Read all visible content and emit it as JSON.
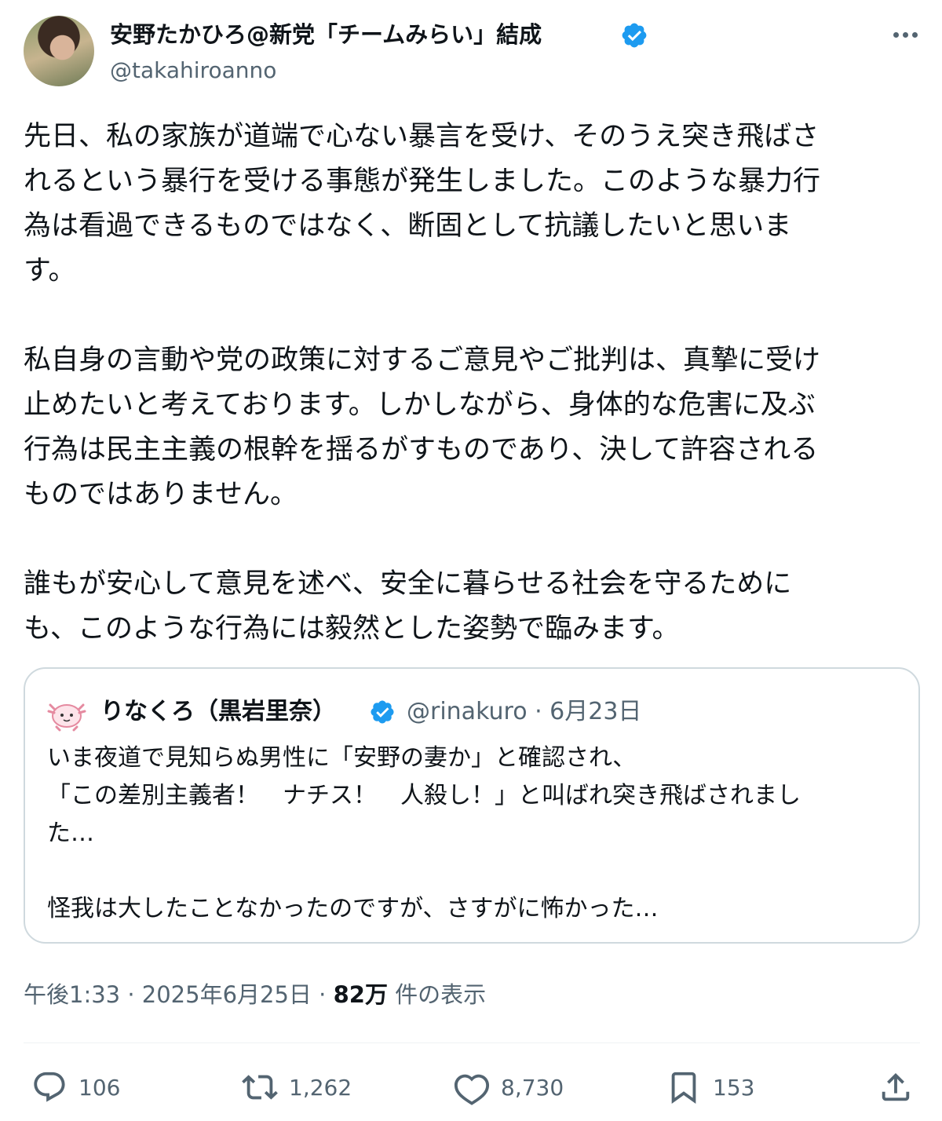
{
  "author": {
    "name": "安野たかひろ@新党「チームみらい」結成",
    "handle": "@takahiroanno"
  },
  "tweet": {
    "lines": [
      "先日、私の家族が道端で心ない暴言を受け、そのうえ突き飛ばさ",
      "れるという暴行を受ける事態が発生しました。このような暴力行",
      "為は看過できるものではなく、断固として抗議したいと思いま",
      "す。",
      "私自身の言動や党の政策に対するご意見やご批判は、真摯に受け",
      "止めたいと考えております。しかしながら、身体的な危害に及ぶ",
      "行為は民主主義の根幹を揺るがすものであり、決して許容される",
      "ものではありません。",
      "誰もが安心して意見を述べ、安全に暮らせる社会を守るために",
      "も、このような行為には毅然とした姿勢で臨みます。"
    ]
  },
  "quote": {
    "name": "りなくろ（黒岩里奈）",
    "meta": "@rinakuro · 6月23日",
    "lines": [
      "いま夜道で見知らぬ男性に「安野の妻か」と確認され、",
      "「この差別主義者！　ナチス！　人殺し！」と叫ばれ突き飛ばされまし",
      "た…",
      "怪我は大したことなかったのですが、さすがに怖かった…"
    ]
  },
  "meta": {
    "time": "午後1:33 · 2025年6月25日 · ",
    "views": "82万",
    "views_label": " 件の表示"
  },
  "actions": {
    "replies": "106",
    "reposts": "1,262",
    "likes": "8,730",
    "bookmarks": "153"
  },
  "icons": {
    "verified_color": "#1d9bf0",
    "action_color": "#536471",
    "more": "more-icon",
    "reply": "reply-icon",
    "repost": "repost-icon",
    "like": "like-icon",
    "bookmark": "bookmark-icon",
    "share": "share-icon"
  }
}
